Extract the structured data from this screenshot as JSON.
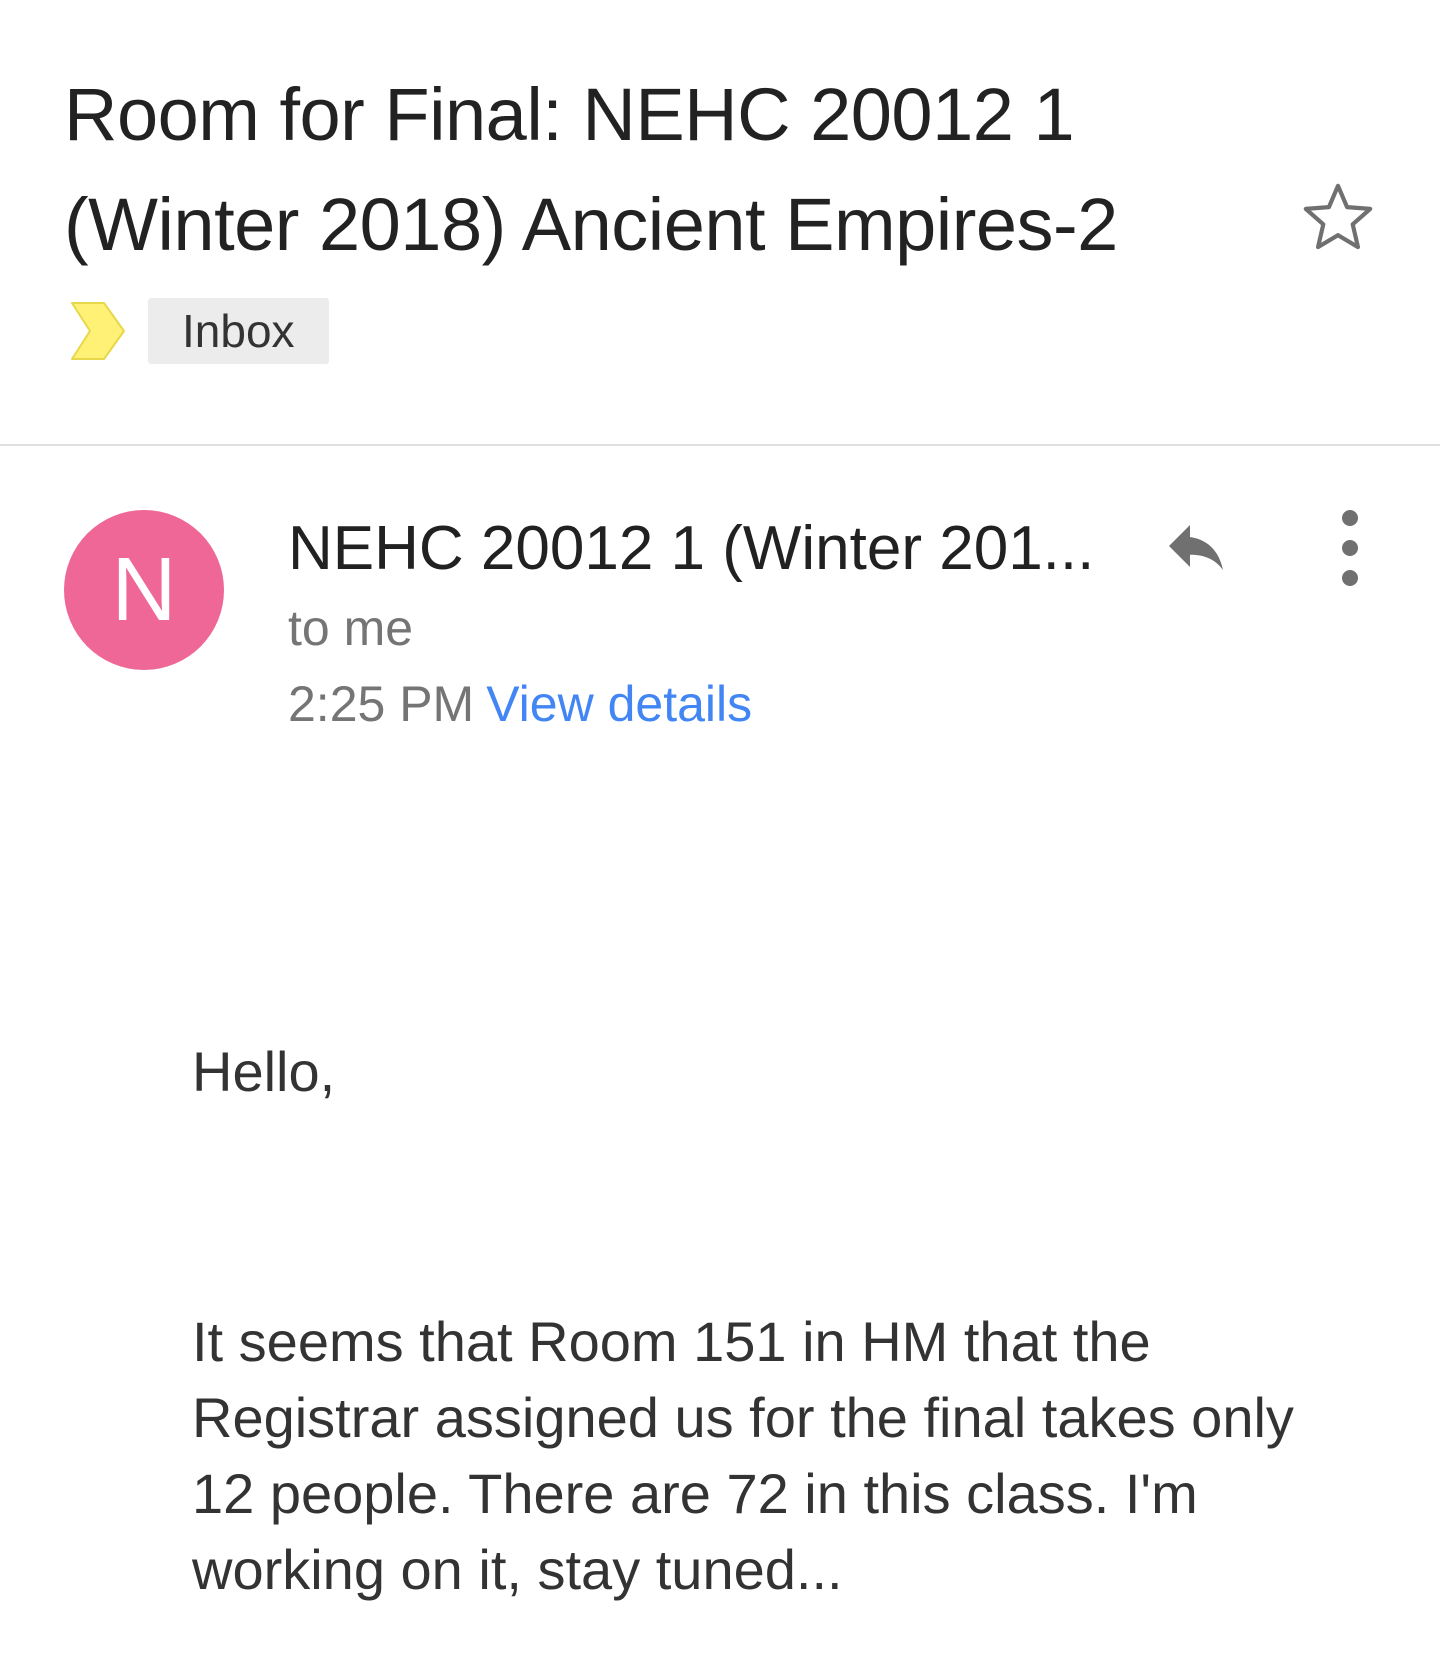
{
  "subject": "Room for Final: NEHC 20012 1 (Winter 2018) Ancient Empires-2",
  "labels": {
    "inbox": "Inbox"
  },
  "message": {
    "avatar_letter": "N",
    "sender": "NEHC 20012 1 (Winter 201...",
    "recipient": "to me",
    "time": "2:25 PM",
    "view_details": "View details",
    "body": {
      "greeting": "Hello,",
      "paragraph": "It seems that Room 151 in HM that the Registrar assigned us for the final takes only 12 people. There are 72 in this class. I'm working on it, stay tuned..."
    }
  },
  "colors": {
    "avatar_bg": "#ef6796",
    "link": "#4285f4",
    "importance_marker": "#fff176"
  },
  "icons": {
    "star": "star-outline-icon",
    "importance": "importance-marker-icon",
    "reply": "reply-icon",
    "more": "more-vert-icon"
  }
}
